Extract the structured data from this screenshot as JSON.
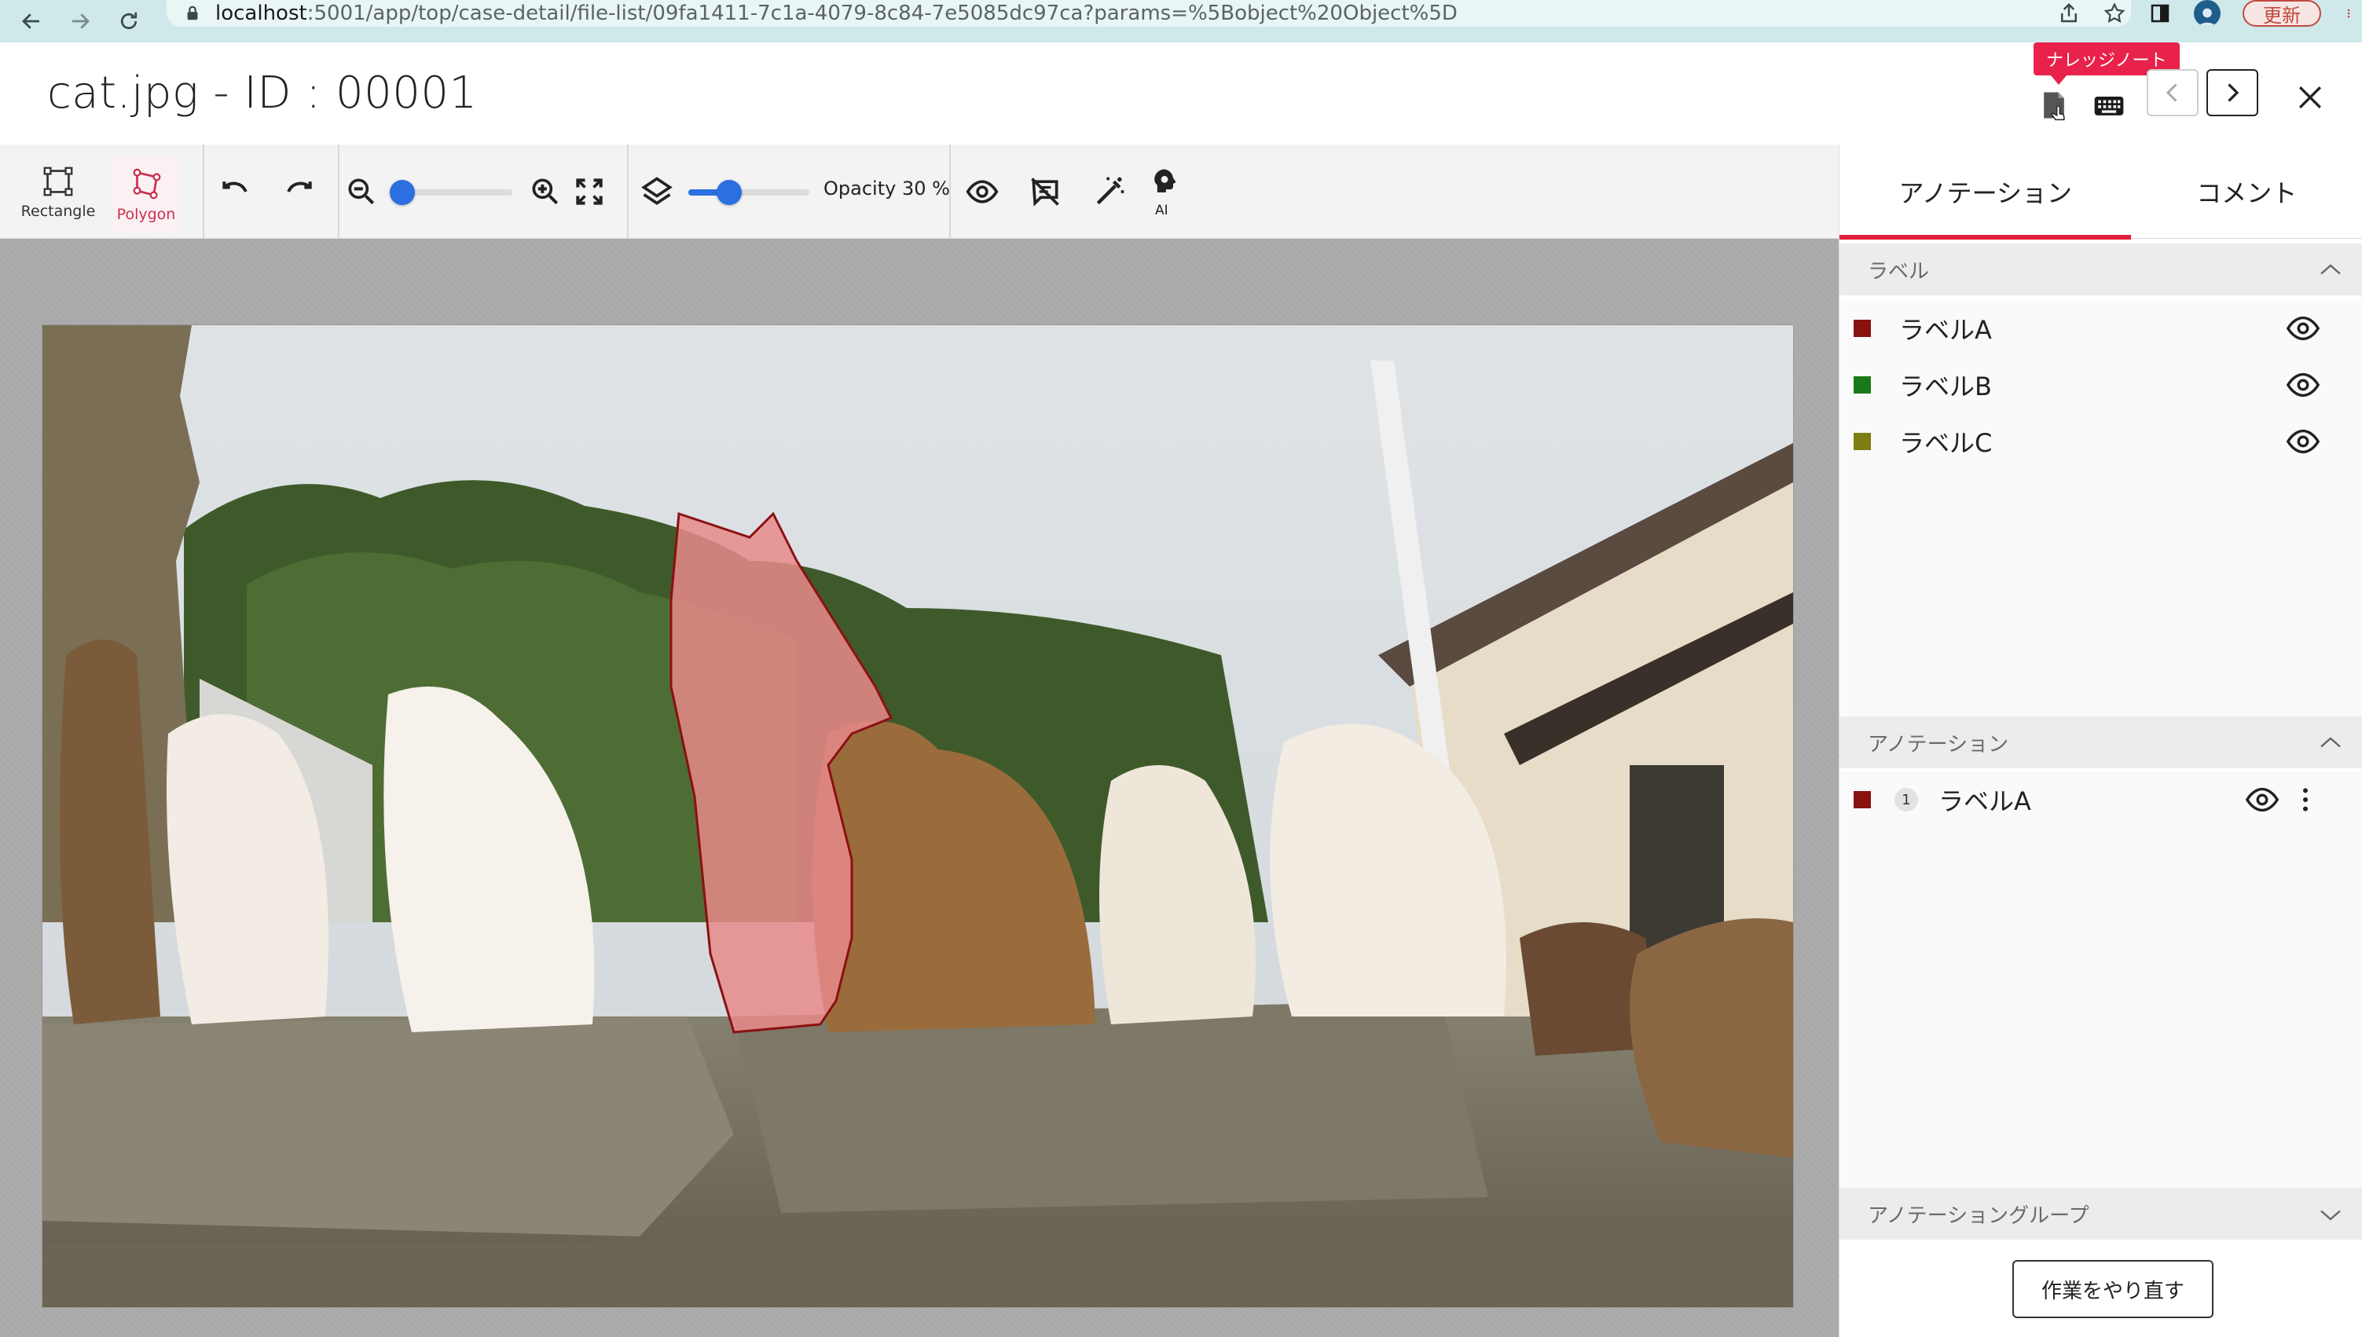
{
  "browser": {
    "url_host": "localhost",
    "url_path": ":5001/app/top/case-detail/file-list/09fa1411-7c1a-4079-8c84-7e5085dc97ca?params=%5Bobject%20Object%5D",
    "update_label": "更新"
  },
  "header": {
    "title": "cat.jpg - ID : 00001",
    "tooltip": "ナレッジノート"
  },
  "toolbar": {
    "rectangle_label": "Rectangle",
    "polygon_label": "Polygon",
    "opacity_label": "Opacity 30 %",
    "ai_label": "AI",
    "zoom_level": 0.0,
    "opacity_value": 30
  },
  "right_panel": {
    "tabs": [
      {
        "label": "アノテーション",
        "active": true
      },
      {
        "label": "コメント",
        "active": false
      }
    ],
    "labels_section": {
      "title": "ラベル",
      "items": [
        {
          "name": "ラベルA",
          "color": "#8b1111"
        },
        {
          "name": "ラベルB",
          "color": "#1a7a1a"
        },
        {
          "name": "ラベルC",
          "color": "#7d7d12"
        }
      ]
    },
    "annotations_section": {
      "title": "アノテーション",
      "items": [
        {
          "index": "1",
          "label": "ラベルA",
          "color": "#8b1111"
        }
      ]
    },
    "groups_section": {
      "title": "アノテーショングループ"
    },
    "redo_button": "作業をやり直す"
  },
  "colors": {
    "accent": "#e0203d",
    "slider": "#2b6fe0",
    "polygon_fill": "#e88a8a"
  }
}
